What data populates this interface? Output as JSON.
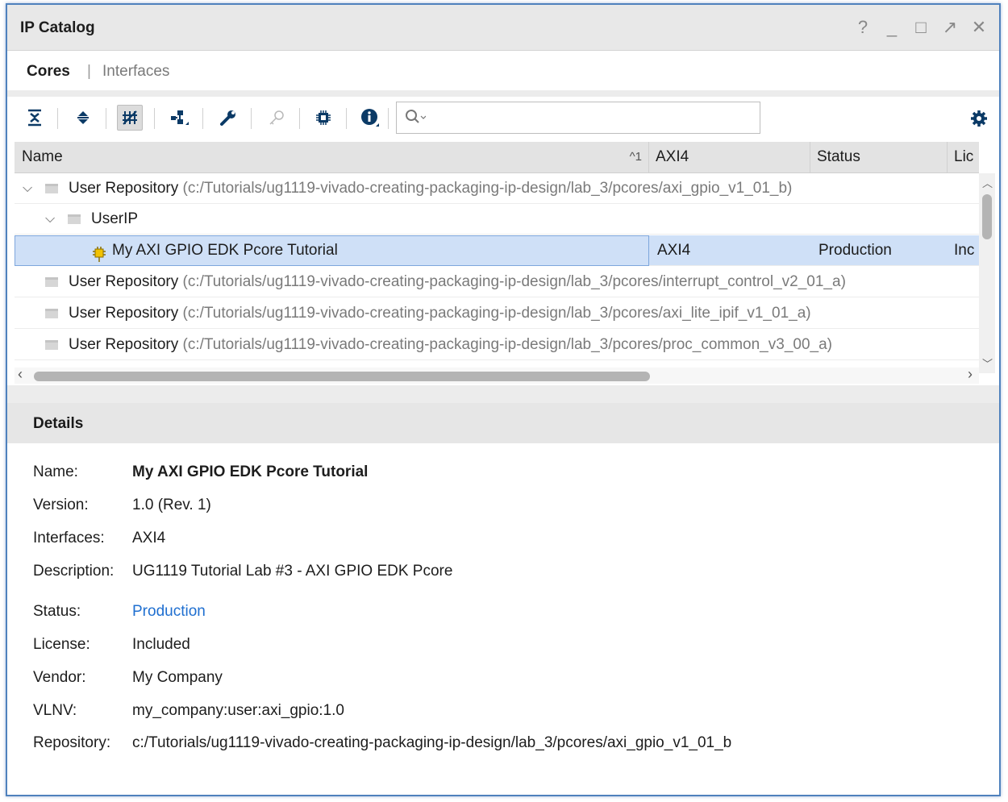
{
  "window": {
    "title": "IP Catalog"
  },
  "window_controls": [
    "?",
    "_",
    "□",
    "↗",
    "✕"
  ],
  "tabs": {
    "cores": "Cores",
    "separator": "|",
    "interfaces": "Interfaces"
  },
  "search": {
    "placeholder": "",
    "value": ""
  },
  "toolbar": {
    "buttons": [
      "collapse-all-icon",
      "expand-all-icon",
      "group-by-icon",
      "hierarchy-icon",
      "wrench-icon",
      "key-icon",
      "chip-icon",
      "info-icon"
    ],
    "gear": "gear-icon"
  },
  "grid": {
    "columns": {
      "name": "Name",
      "sort_indicator": "^1",
      "axi": "AXI4",
      "status": "Status",
      "lic": "Lic"
    },
    "rows": [
      {
        "type": "repo",
        "expanded": true,
        "label": "User Repository",
        "path": "(c:/Tutorials/ug1119-vivado-creating-packaging-ip-design/lab_3/pcores/axi_gpio_v1_01_b)"
      },
      {
        "type": "folder",
        "expanded": true,
        "label": "UserIP"
      },
      {
        "type": "ip",
        "label": "My AXI GPIO EDK Pcore Tutorial",
        "axi": "AXI4",
        "status": "Production",
        "lic": "Inc"
      },
      {
        "type": "repo",
        "label": "User Repository",
        "path": "(c:/Tutorials/ug1119-vivado-creating-packaging-ip-design/lab_3/pcores/interrupt_control_v2_01_a)"
      },
      {
        "type": "repo",
        "label": "User Repository",
        "path": "(c:/Tutorials/ug1119-vivado-creating-packaging-ip-design/lab_3/pcores/axi_lite_ipif_v1_01_a)"
      },
      {
        "type": "repo",
        "label": "User Repository",
        "path": "(c:/Tutorials/ug1119-vivado-creating-packaging-ip-design/lab_3/pcores/proc_common_v3_00_a)"
      }
    ]
  },
  "details": {
    "title": "Details",
    "name_label": "Name:",
    "name": "My AXI GPIO EDK Pcore Tutorial",
    "version_label": "Version:",
    "version": "1.0 (Rev. 1)",
    "interfaces_label": "Interfaces:",
    "interfaces": "AXI4",
    "description_label": "Description:",
    "description": "UG1119 Tutorial Lab #3 - AXI GPIO EDK Pcore",
    "status_label": "Status:",
    "status": "Production",
    "license_label": "License:",
    "license": "Included",
    "vendor_label": "Vendor:",
    "vendor": "My Company",
    "vlnv_label": "VLNV:",
    "vlnv": "my_company:user:axi_gpio:1.0",
    "repository_label": "Repository:",
    "repository": "c:/Tutorials/ug1119-vivado-creating-packaging-ip-design/lab_3/pcores/axi_gpio_v1_01_b"
  },
  "colors": {
    "accent": "#4f81bd",
    "selection": "#cfe0f7",
    "link": "#1f6fd0",
    "icon_blue": "#0b3a66"
  }
}
